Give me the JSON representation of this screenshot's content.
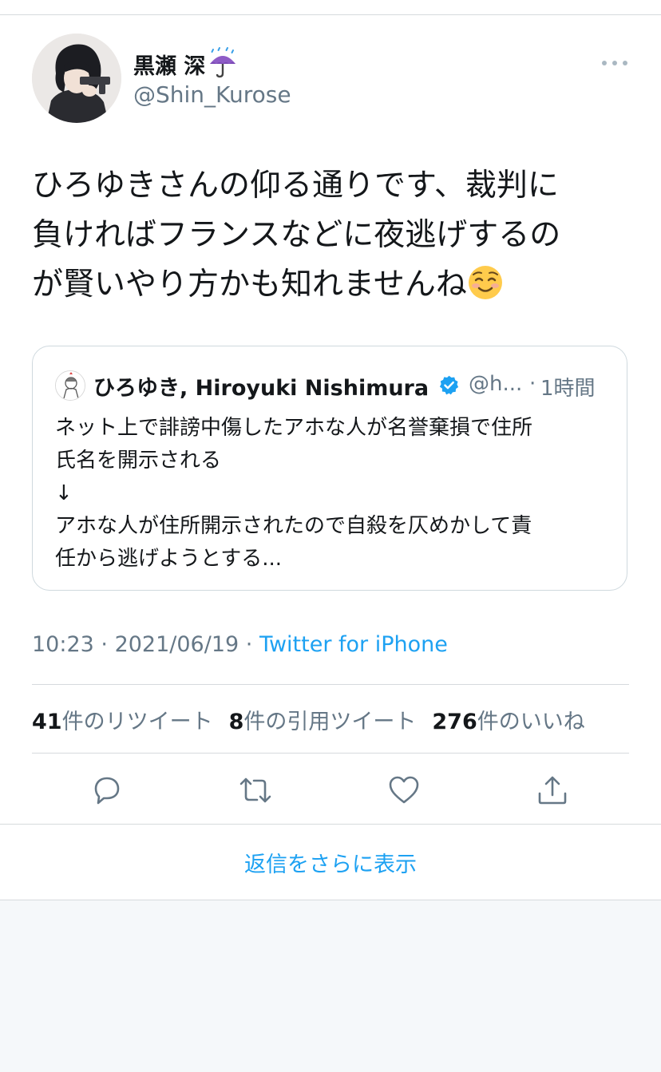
{
  "author": {
    "name": "黒瀬 深",
    "name_emoji": "umbrella-with-rain-icon",
    "handle": "@Shin_Kurose"
  },
  "tweet": {
    "lines": [
      "ひろゆきさんの仰る通りです、裁判に",
      "負ければフランスなどに夜逃げするの",
      "が賢いやり方かも知れませんね"
    ],
    "trailing_emoji": "smiling-face-icon"
  },
  "quoted": {
    "name": "ひろゆき, Hiroyuki Nishimura",
    "handle": "@h...",
    "separator": "·",
    "time": "1時間",
    "lines": [
      "ネット上で誹謗中傷したアホな人が名誉棄損で住所",
      "氏名を開示される",
      "↓",
      "アホな人が住所開示されたので自殺を仄めかして責",
      "任から逃げようとする..."
    ]
  },
  "meta": {
    "time": "10:23",
    "sep1": " · ",
    "date": "2021/06/19",
    "sep2": " · ",
    "source": "Twitter for iPhone"
  },
  "stats": {
    "retweets_num": "41",
    "retweets_label": "件のリツイート",
    "quotes_num": "8",
    "quotes_label": "件の引用ツイート",
    "likes_num": "276",
    "likes_label": "件のいいね"
  },
  "actions": [
    "reply-icon",
    "retweet-icon",
    "like-icon",
    "share-icon"
  ],
  "more_replies": "返信をさらに表示",
  "colors": {
    "accent": "#1da1f2",
    "secondary_text": "#657786",
    "divider": "#d6dadd",
    "footer_bg": "#f5f8fa"
  }
}
